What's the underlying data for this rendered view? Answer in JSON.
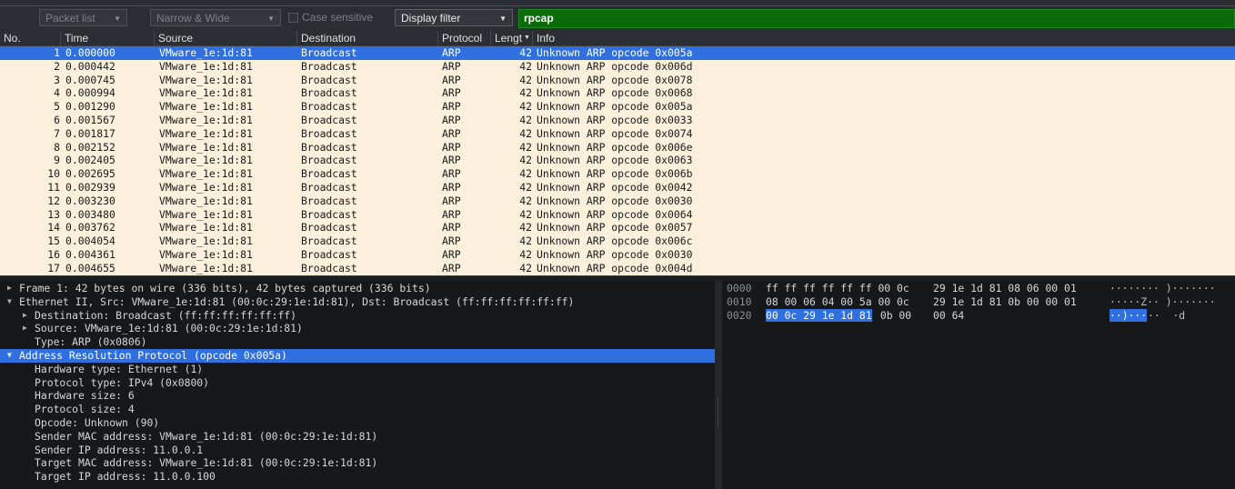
{
  "filter_toolbar": {
    "packet_list_label": "Packet list",
    "encoding_label": "Narrow & Wide",
    "case_sensitive_label": "Case sensitive",
    "filter_type_label": "Display filter",
    "search_value": "rpcap"
  },
  "columns": [
    {
      "key": "no",
      "label": "No."
    },
    {
      "key": "time",
      "label": "Time"
    },
    {
      "key": "source",
      "label": "Source"
    },
    {
      "key": "destination",
      "label": "Destination"
    },
    {
      "key": "protocol",
      "label": "Protocol"
    },
    {
      "key": "length",
      "label": "Lengt"
    },
    {
      "key": "info",
      "label": "Info"
    }
  ],
  "packets": [
    {
      "no": "1",
      "time": "0.000000",
      "source": "VMware_1e:1d:81",
      "destination": "Broadcast",
      "protocol": "ARP",
      "length": "42",
      "info": "Unknown ARP opcode 0x005a"
    },
    {
      "no": "2",
      "time": "0.000442",
      "source": "VMware_1e:1d:81",
      "destination": "Broadcast",
      "protocol": "ARP",
      "length": "42",
      "info": "Unknown ARP opcode 0x006d"
    },
    {
      "no": "3",
      "time": "0.000745",
      "source": "VMware_1e:1d:81",
      "destination": "Broadcast",
      "protocol": "ARP",
      "length": "42",
      "info": "Unknown ARP opcode 0x0078"
    },
    {
      "no": "4",
      "time": "0.000994",
      "source": "VMware_1e:1d:81",
      "destination": "Broadcast",
      "protocol": "ARP",
      "length": "42",
      "info": "Unknown ARP opcode 0x0068"
    },
    {
      "no": "5",
      "time": "0.001290",
      "source": "VMware_1e:1d:81",
      "destination": "Broadcast",
      "protocol": "ARP",
      "length": "42",
      "info": "Unknown ARP opcode 0x005a"
    },
    {
      "no": "6",
      "time": "0.001567",
      "source": "VMware_1e:1d:81",
      "destination": "Broadcast",
      "protocol": "ARP",
      "length": "42",
      "info": "Unknown ARP opcode 0x0033"
    },
    {
      "no": "7",
      "time": "0.001817",
      "source": "VMware_1e:1d:81",
      "destination": "Broadcast",
      "protocol": "ARP",
      "length": "42",
      "info": "Unknown ARP opcode 0x0074"
    },
    {
      "no": "8",
      "time": "0.002152",
      "source": "VMware_1e:1d:81",
      "destination": "Broadcast",
      "protocol": "ARP",
      "length": "42",
      "info": "Unknown ARP opcode 0x006e"
    },
    {
      "no": "9",
      "time": "0.002405",
      "source": "VMware_1e:1d:81",
      "destination": "Broadcast",
      "protocol": "ARP",
      "length": "42",
      "info": "Unknown ARP opcode 0x0063"
    },
    {
      "no": "10",
      "time": "0.002695",
      "source": "VMware_1e:1d:81",
      "destination": "Broadcast",
      "protocol": "ARP",
      "length": "42",
      "info": "Unknown ARP opcode 0x006b"
    },
    {
      "no": "11",
      "time": "0.002939",
      "source": "VMware_1e:1d:81",
      "destination": "Broadcast",
      "protocol": "ARP",
      "length": "42",
      "info": "Unknown ARP opcode 0x0042"
    },
    {
      "no": "12",
      "time": "0.003230",
      "source": "VMware_1e:1d:81",
      "destination": "Broadcast",
      "protocol": "ARP",
      "length": "42",
      "info": "Unknown ARP opcode 0x0030"
    },
    {
      "no": "13",
      "time": "0.003480",
      "source": "VMware_1e:1d:81",
      "destination": "Broadcast",
      "protocol": "ARP",
      "length": "42",
      "info": "Unknown ARP opcode 0x0064"
    },
    {
      "no": "14",
      "time": "0.003762",
      "source": "VMware_1e:1d:81",
      "destination": "Broadcast",
      "protocol": "ARP",
      "length": "42",
      "info": "Unknown ARP opcode 0x0057"
    },
    {
      "no": "15",
      "time": "0.004054",
      "source": "VMware_1e:1d:81",
      "destination": "Broadcast",
      "protocol": "ARP",
      "length": "42",
      "info": "Unknown ARP opcode 0x006c"
    },
    {
      "no": "16",
      "time": "0.004361",
      "source": "VMware_1e:1d:81",
      "destination": "Broadcast",
      "protocol": "ARP",
      "length": "42",
      "info": "Unknown ARP opcode 0x0030"
    },
    {
      "no": "17",
      "time": "0.004655",
      "source": "VMware_1e:1d:81",
      "destination": "Broadcast",
      "protocol": "ARP",
      "length": "42",
      "info": "Unknown ARP opcode 0x004d"
    }
  ],
  "selected_packet": "1",
  "details": [
    {
      "level": 0,
      "expander": "collapsed",
      "text": "Frame 1: 42 bytes on wire (336 bits), 42 bytes captured (336 bits)"
    },
    {
      "level": 0,
      "expander": "expanded",
      "text": "Ethernet II, Src: VMware_1e:1d:81 (00:0c:29:1e:1d:81), Dst: Broadcast (ff:ff:ff:ff:ff:ff)"
    },
    {
      "level": 1,
      "expander": "collapsed",
      "text": "Destination: Broadcast (ff:ff:ff:ff:ff:ff)"
    },
    {
      "level": 1,
      "expander": "collapsed",
      "text": "Source: VMware_1e:1d:81 (00:0c:29:1e:1d:81)"
    },
    {
      "level": 1,
      "expander": "none",
      "text": "Type: ARP (0x0806)"
    },
    {
      "level": 0,
      "expander": "expanded",
      "text": "Address Resolution Protocol (opcode 0x005a)",
      "selected": true
    },
    {
      "level": 1,
      "expander": "none",
      "text": "Hardware type: Ethernet (1)"
    },
    {
      "level": 1,
      "expander": "none",
      "text": "Protocol type: IPv4 (0x0800)"
    },
    {
      "level": 1,
      "expander": "none",
      "text": "Hardware size: 6"
    },
    {
      "level": 1,
      "expander": "none",
      "text": "Protocol size: 4"
    },
    {
      "level": 1,
      "expander": "none",
      "text": "Opcode: Unknown (90)"
    },
    {
      "level": 1,
      "expander": "none",
      "text": "Sender MAC address: VMware_1e:1d:81 (00:0c:29:1e:1d:81)"
    },
    {
      "level": 1,
      "expander": "none",
      "text": "Sender IP address: 11.0.0.1"
    },
    {
      "level": 1,
      "expander": "none",
      "text": "Target MAC address: VMware_1e:1d:81 (00:0c:29:1e:1d:81)"
    },
    {
      "level": 1,
      "expander": "none",
      "text": "Target IP address: 11.0.0.100"
    }
  ],
  "hex_dump": [
    {
      "offset": "0000",
      "hex_a": "ff ff ff ff ff ff 00 0c",
      "hex_b": "29 1e 1d 81 08 06 00 01",
      "ascii": "········ )·······"
    },
    {
      "offset": "0010",
      "hex_a": "08 00 06 04 00 5a 00 0c",
      "hex_b": "29 1e 1d 81 0b 00 00 01",
      "ascii": "·····Z·· )·······"
    },
    {
      "offset": "0020",
      "hex_hl": "00 0c 29 1e 1d 81",
      "hex_rest": " 0b 00",
      "hex_b": "00 64",
      "ascii_hl": "··)···",
      "ascii_rest": "··  ·d"
    }
  ],
  "colors": {
    "list_background": "#faf0dc",
    "selection": "#2f6fe0",
    "filter_valid": "#0b6b0b"
  }
}
